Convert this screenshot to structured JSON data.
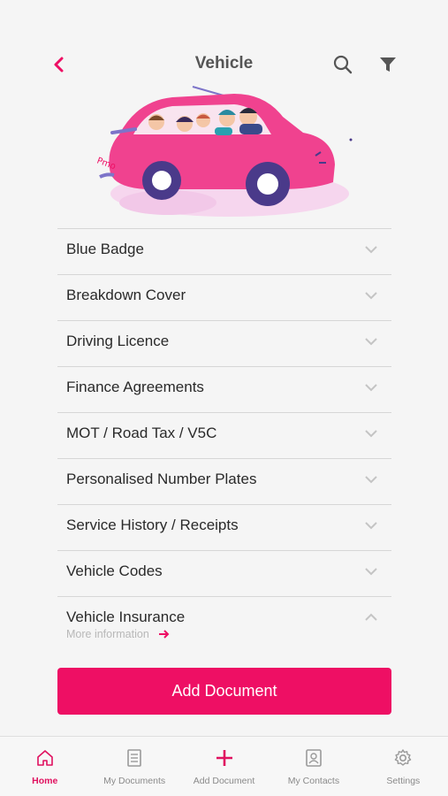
{
  "header": {
    "title": "Vehicle",
    "back_icon": "chevron-left-icon",
    "search_icon": "search-icon",
    "filter_icon": "filter-icon"
  },
  "colors": {
    "accent": "#ee0f64",
    "text": "#2a2a2a",
    "muted": "#b8b8b8"
  },
  "categories": [
    {
      "label": "Blue Badge",
      "expanded": false
    },
    {
      "label": "Breakdown Cover",
      "expanded": false
    },
    {
      "label": "Driving Licence",
      "expanded": false
    },
    {
      "label": "Finance Agreements",
      "expanded": false
    },
    {
      "label": "MOT / Road Tax / V5C",
      "expanded": false
    },
    {
      "label": "Personalised Number Plates",
      "expanded": false
    },
    {
      "label": "Service History / Receipts",
      "expanded": false
    },
    {
      "label": "Vehicle Codes",
      "expanded": false
    },
    {
      "label": "Vehicle Insurance",
      "expanded": true,
      "more_label": "More information"
    }
  ],
  "add_button_label": "Add Document",
  "tabs": [
    {
      "label": "Home",
      "icon": "home-icon",
      "active": true
    },
    {
      "label": "My Documents",
      "icon": "documents-icon",
      "active": false
    },
    {
      "label": "Add Document",
      "icon": "plus-icon",
      "active": false
    },
    {
      "label": "My Contacts",
      "icon": "contacts-icon",
      "active": false
    },
    {
      "label": "Settings",
      "icon": "gear-icon",
      "active": false
    }
  ]
}
